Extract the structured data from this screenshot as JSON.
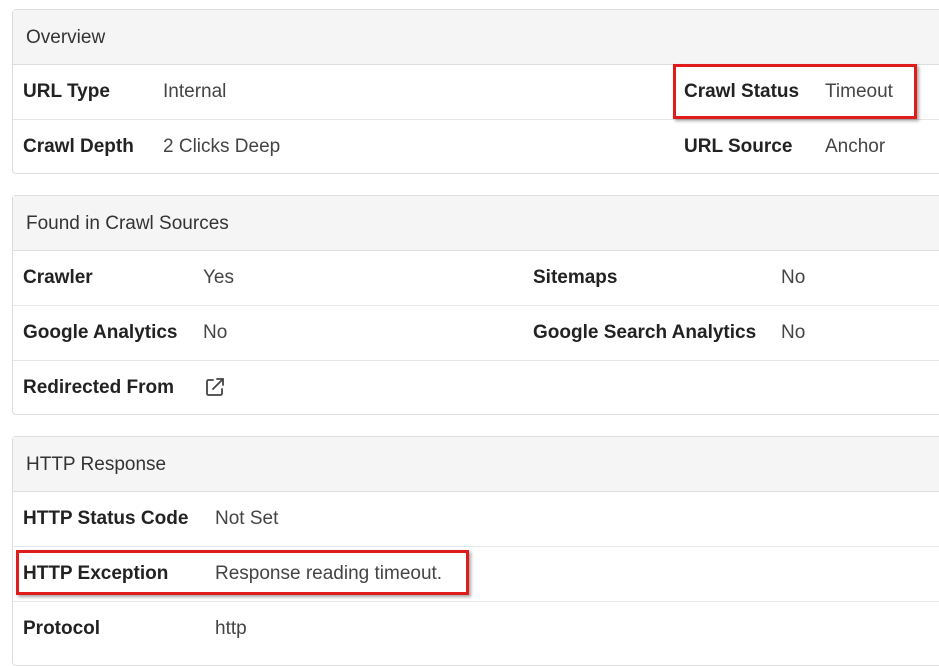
{
  "overview": {
    "title": "Overview",
    "url_type_label": "URL Type",
    "url_type_value": "Internal",
    "crawl_status_label": "Crawl Status",
    "crawl_status_value": "Timeout",
    "crawl_depth_label": "Crawl Depth",
    "crawl_depth_value": "2 Clicks Deep",
    "url_source_label": "URL Source",
    "url_source_value": "Anchor"
  },
  "crawl_sources": {
    "title": "Found in Crawl Sources",
    "crawler_label": "Crawler",
    "crawler_value": "Yes",
    "sitemaps_label": "Sitemaps",
    "sitemaps_value": "No",
    "ga_label": "Google Analytics",
    "ga_value": "No",
    "gsa_label": "Google Search Analytics",
    "gsa_value": "No",
    "redirected_label": "Redirected From",
    "redirected_icon": "external-link-icon"
  },
  "http_response": {
    "title": "HTTP Response",
    "status_code_label": "HTTP Status Code",
    "status_code_value": "Not Set",
    "exception_label": "HTTP Exception",
    "exception_value": "Response reading timeout.",
    "protocol_label": "Protocol",
    "protocol_value": "http"
  },
  "colors": {
    "highlight": "#e01b1b",
    "heading_bg": "#f5f5f5",
    "border": "#dddddd"
  }
}
